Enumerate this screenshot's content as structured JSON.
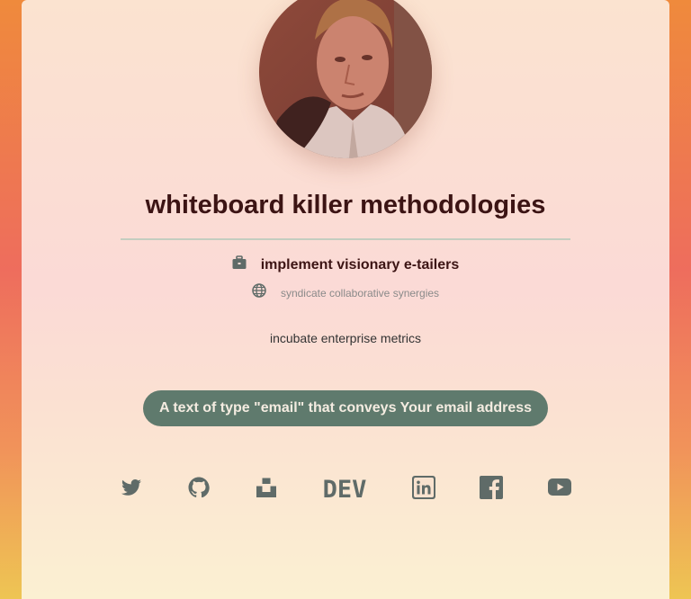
{
  "profile": {
    "name": "whiteboard killer methodologies",
    "job": "implement visionary e-tailers",
    "location": "syndicate collaborative synergies",
    "bio": "incubate enterprise metrics",
    "email_button": "A text of type \"email\" that conveys Your email address"
  },
  "icons": {
    "job": "briefcase-icon",
    "location": "globe-icon",
    "color": "#5f6b68"
  },
  "social_links": [
    {
      "name": "twitter-icon"
    },
    {
      "name": "github-icon"
    },
    {
      "name": "unsplash-icon"
    },
    {
      "name": "dev-icon",
      "text": "DEV"
    },
    {
      "name": "linkedin-icon"
    },
    {
      "name": "facebook-icon"
    },
    {
      "name": "youtube-icon"
    }
  ],
  "colors": {
    "heading": "#3c1414",
    "button": "#5f7a6d",
    "button_text": "#f4ece1"
  }
}
